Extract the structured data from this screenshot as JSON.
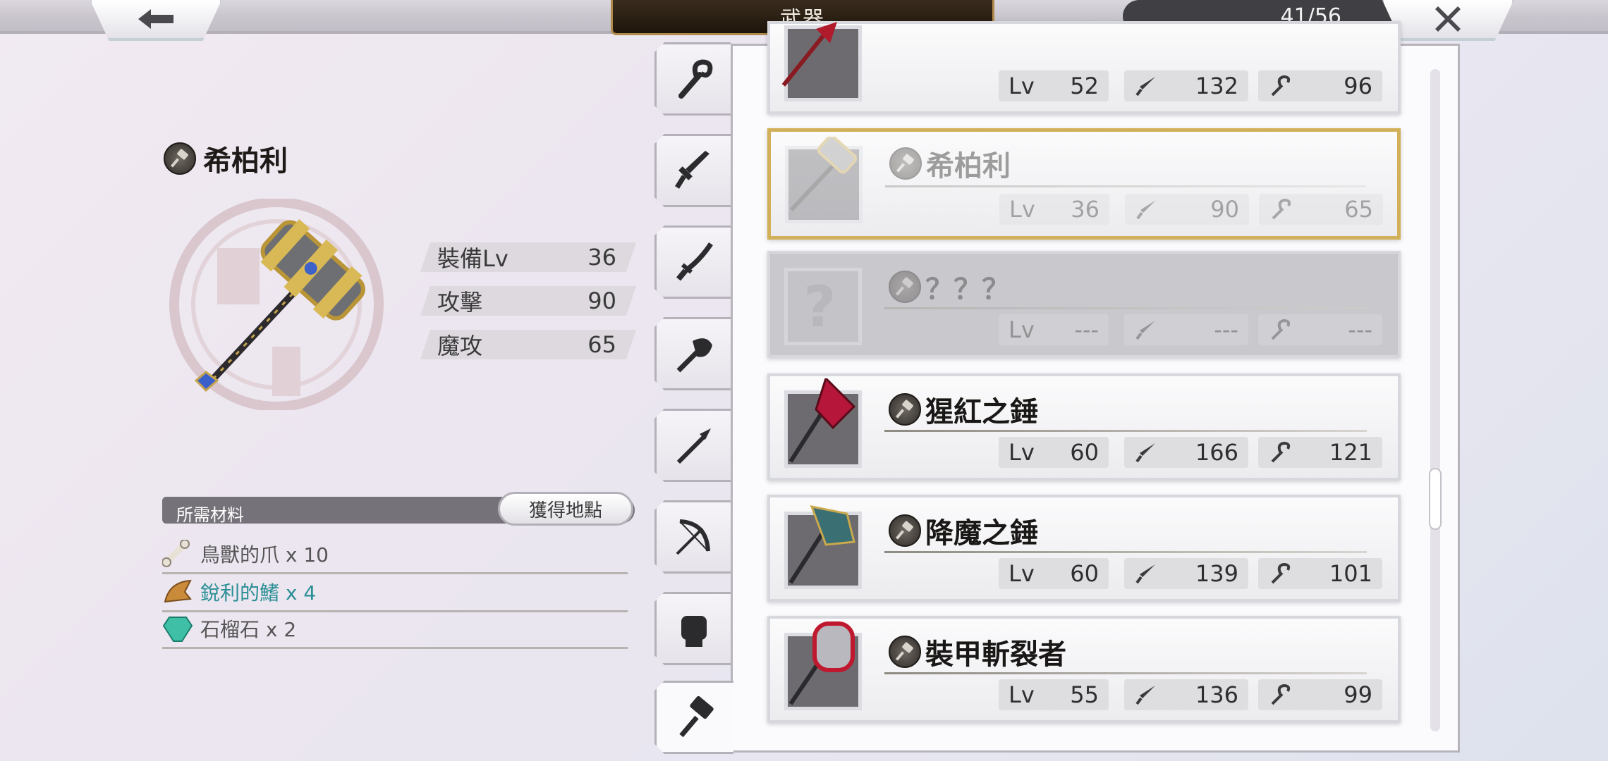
{
  "header": {
    "title": "武器",
    "counter": "41/56",
    "back_icon": "arrow-left-icon",
    "close_icon": "close-icon"
  },
  "detail": {
    "name": "希柏利",
    "stats": [
      {
        "label": "裝備Lv",
        "value": "36"
      },
      {
        "label": "攻擊",
        "value": "90"
      },
      {
        "label": "魔攻",
        "value": "65"
      }
    ]
  },
  "materials": {
    "header": "所需材料",
    "get_button": "獲得地點",
    "items": [
      {
        "text": "鳥獸的爪 x 10",
        "icon": "bone-icon",
        "highlight": false
      },
      {
        "text": "銳利的鰭 x 4",
        "icon": "fin-icon",
        "highlight": true
      },
      {
        "text": "石榴石 x 2",
        "icon": "gem-icon",
        "highlight": false
      }
    ]
  },
  "tabs": [
    "staff-icon",
    "sword-icon",
    "katana-icon",
    "axe-icon",
    "spear-icon",
    "bow-icon",
    "fist-icon",
    "hammer-icon"
  ],
  "list": [
    {
      "name": "",
      "lv": "52",
      "atk": "132",
      "mag": "96"
    },
    {
      "name": "希柏利",
      "lv": "36",
      "atk": "90",
      "mag": "65"
    },
    {
      "name": "？？？",
      "lv": "---",
      "atk": "---",
      "mag": "---"
    },
    {
      "name": "猩紅之錘",
      "lv": "60",
      "atk": "166",
      "mag": "121"
    },
    {
      "name": "降魔之錘",
      "lv": "60",
      "atk": "139",
      "mag": "101"
    },
    {
      "name": "裝甲斬裂者",
      "lv": "55",
      "atk": "136",
      "mag": "99"
    }
  ],
  "lv_label": "Lv",
  "colors": {
    "accent_gold": "#d2b05a",
    "teal": "#2a8f95"
  }
}
